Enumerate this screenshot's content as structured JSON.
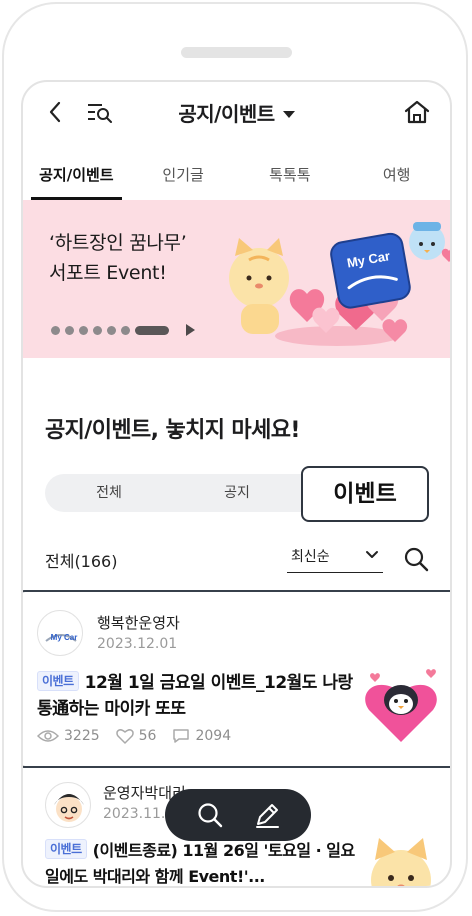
{
  "header": {
    "title": "공지/이벤트",
    "icons": {
      "back": "back-arrow-icon",
      "menu": "menu-search-icon",
      "home": "home-icon"
    }
  },
  "tabs": [
    "공지/이벤트",
    "인기글",
    "톡톡톡",
    "여행"
  ],
  "banner": {
    "title": "‘하트장인 꿈나무’\n서포트 Event!",
    "badge_text": "My Car",
    "slide_count": 7,
    "active_slide": 7,
    "background": "#fcdde3"
  },
  "headline": "공지/이벤트, 놓치지 마세요!",
  "filter": {
    "options": [
      "전체",
      "공지",
      "이벤트"
    ],
    "selected": "이벤트"
  },
  "list": {
    "count_label": "전체(166)",
    "sort_value": "최신순"
  },
  "posts": [
    {
      "author": "행복한운영자",
      "date": "2023.12.01",
      "avatar_text": "My Car",
      "tag": "이벤트",
      "title": "12월 1일 금요일 이벤트_12월도 나랑 통通하는 마이카 또또",
      "views": "3225",
      "likes": "56",
      "comments": "2094"
    },
    {
      "author": "운영자박대리",
      "date": "2023.11.2",
      "tag": "이벤트",
      "title": "(이벤트종료) 11월 26일 '토요일 · 일요일에도 박대리와 함께 Event!'..."
    }
  ],
  "colors": {
    "accent_blue": "#4a6fd6",
    "dark": "#262a30",
    "banner_pink": "#fcdde3"
  }
}
